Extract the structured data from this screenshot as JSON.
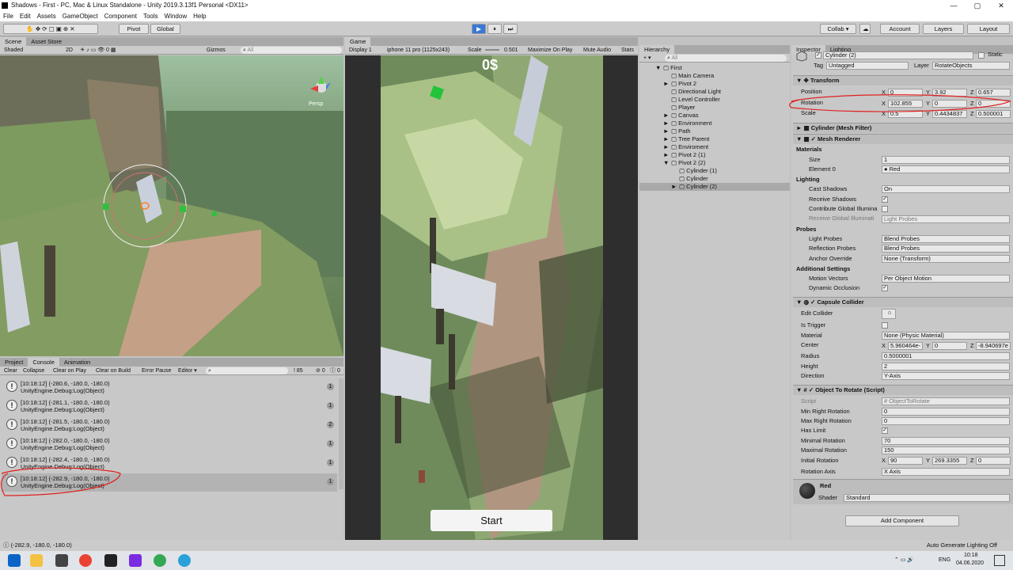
{
  "window": {
    "title": "Shadows - First - PC, Mac & Linux Standalone - Unity 2019.3.13f1 Personal <DX11>",
    "controls": [
      "—",
      "▢",
      "✕"
    ]
  },
  "menu": [
    "File",
    "Edit",
    "Assets",
    "GameObject",
    "Component",
    "Tools",
    "Window",
    "Help"
  ],
  "toolbar": {
    "pivot": "Pivot",
    "global": "Global",
    "collab": "Collab ▾",
    "account": "Account",
    "layers": "Layers",
    "layout": "Layout"
  },
  "scene": {
    "tabs": [
      "Scene",
      "Asset Store"
    ],
    "shading": "Shaded",
    "mode2d": "2D",
    "gizmos": "Gizmos",
    "search_placeholder": "All",
    "zero": "0",
    "persp": "Persp"
  },
  "game": {
    "tab": "Game",
    "display": "Display 1",
    "resolution": "iphone 11 pro (1125x243)",
    "scale_label": "Scale",
    "scale_value": "0.501",
    "maximize": "Maximize On Play",
    "mute": "Mute Audio",
    "stats": "Stats",
    "money": "0$",
    "start": "Start"
  },
  "hierarchy": {
    "tab": "Hierarchy",
    "plus": "+ ▾",
    "search_placeholder": "All",
    "items": [
      {
        "label": "First",
        "indent": 0,
        "arrow": "▼"
      },
      {
        "label": "Main Camera",
        "indent": 1,
        "arrow": ""
      },
      {
        "label": "Pivot 2",
        "indent": 1,
        "arrow": "►"
      },
      {
        "label": "Directional Light",
        "indent": 1,
        "arrow": ""
      },
      {
        "label": "Level Controller",
        "indent": 1,
        "arrow": ""
      },
      {
        "label": "Player",
        "indent": 1,
        "arrow": ""
      },
      {
        "label": "Canvas",
        "indent": 1,
        "arrow": "►"
      },
      {
        "label": "Environment",
        "indent": 1,
        "arrow": "►"
      },
      {
        "label": "Path",
        "indent": 1,
        "arrow": "►"
      },
      {
        "label": "Tree Parent",
        "indent": 1,
        "arrow": "►"
      },
      {
        "label": "Enviroment",
        "indent": 1,
        "arrow": "►"
      },
      {
        "label": "Pivot 2 (1)",
        "indent": 1,
        "arrow": "►"
      },
      {
        "label": "Pivot 2 (2)",
        "indent": 1,
        "arrow": "▼"
      },
      {
        "label": "Cylinder (1)",
        "indent": 2,
        "arrow": ""
      },
      {
        "label": "Cylinder",
        "indent": 2,
        "arrow": ""
      },
      {
        "label": "Cylinder (2)",
        "indent": 2,
        "arrow": "►",
        "selected": true
      }
    ]
  },
  "inspector": {
    "tabs": [
      "Inspector",
      "Lighting"
    ],
    "object_name": "Cylinder (2)",
    "static": "Static",
    "tag_label": "Tag",
    "tag": "Untagged",
    "layer_label": "Layer",
    "layer": "RotateObjects",
    "transform": {
      "title": "Transform",
      "position_label": "Position",
      "px": "0",
      "py": "3.92",
      "pz": "0.657",
      "rotation_label": "Rotation",
      "rx": "102.855",
      "ry": "0",
      "rz": "0",
      "scale_label": "Scale",
      "sx": "0.5",
      "sy": "0.4434837",
      "sz": "0.500001"
    },
    "mesh_filter": "Cylinder (Mesh Filter)",
    "mesh_renderer": {
      "title": "Mesh Renderer",
      "materials": "Materials",
      "size_label": "Size",
      "size": "1",
      "element0_label": "Element 0",
      "element0": "Red",
      "lighting": "Lighting",
      "cast_label": "Cast Shadows",
      "cast": "On",
      "receive_label": "Receive Shadows",
      "contribute_label": "Contribute Global Illumina",
      "receive_gi_label": "Receive Global Illuminati",
      "receive_gi": "Light Probes",
      "probes": "Probes",
      "light_probes_label": "Light Probes",
      "light_probes": "Blend Probes",
      "reflection_label": "Reflection Probes",
      "reflection": "Blend Probes",
      "anchor_label": "Anchor Override",
      "anchor": "None (Transform)",
      "additional": "Additional Settings",
      "motion_label": "Motion Vectors",
      "motion": "Per Object Motion",
      "dynamic_label": "Dynamic Occlusion"
    },
    "capsule": {
      "title": "Capsule Collider",
      "edit_label": "Edit Collider",
      "trigger_label": "Is Trigger",
      "material_label": "Material",
      "material": "None (Physic Material)",
      "center_label": "Center",
      "cx": "5.960464e-",
      "cy": "0",
      "cz": "-8.940697e",
      "radius_label": "Radius",
      "radius": "0.5000001",
      "height_label": "Height",
      "height": "2",
      "direction_label": "Direction",
      "direction": "Y-Axis"
    },
    "script_comp": {
      "title": "Object To Rotate (Script)",
      "script_label": "Script",
      "script": "ObjectToRotate",
      "minr_label": "Min Right Rotation",
      "minr": "0",
      "maxr_label": "Max Right Rotation",
      "maxr": "0",
      "haslimit_label": "Has Limit",
      "minimal_label": "Minimal Rotation",
      "minimal": "70",
      "maximal_label": "Maximal Rotation",
      "maximal": "150",
      "initial_label": "Initial Rotation",
      "ix": "90",
      "iy": "269.3355",
      "iz": "0",
      "axis_label": "Rotation Axis",
      "axis": "X Axis"
    },
    "material": {
      "name": "Red",
      "shader_label": "Shader",
      "shader": "Standard"
    },
    "add_component": "Add Component"
  },
  "console": {
    "tabs": [
      "Project",
      "Console",
      "Animation"
    ],
    "buttons": [
      "Clear",
      "Collapse",
      "Clear on Play",
      "Clear on Build",
      "Error Pause",
      "Editor ▾"
    ],
    "count_warn": "85",
    "count_err": "0",
    "count_info": "0",
    "rows": [
      {
        "line1": "[10:18:12] (-280.6, -180.0, -180.0)",
        "line2": "UnityEngine.Debug:Log(Object)",
        "count": "1"
      },
      {
        "line1": "[10:18:12] (-281.1, -180.0, -180.0)",
        "line2": "UnityEngine.Debug:Log(Object)",
        "count": "1"
      },
      {
        "line1": "[10:18:12] (-281.5, -180.0, -180.0)",
        "line2": "UnityEngine.Debug:Log(Object)",
        "count": "2"
      },
      {
        "line1": "[10:18:12] (-282.0, -180.0, -180.0)",
        "line2": "UnityEngine.Debug:Log(Object)",
        "count": "1"
      },
      {
        "line1": "[10:18:12] (-282.4, -180.0, -180.0)",
        "line2": "UnityEngine.Debug:Log(Object)",
        "count": "1"
      },
      {
        "line1": "[10:18:12] (-282.9, -180.0, -180.0)",
        "line2": "UnityEngine.Debug:Log(Object)",
        "count": "1"
      }
    ]
  },
  "status": {
    "left": "(-282.9, -180.0, -180.0)",
    "right": "Auto Generate Lighting Off"
  },
  "taskbar": {
    "lang": "ENG",
    "time": "10:18",
    "date": "04.06.2020"
  }
}
